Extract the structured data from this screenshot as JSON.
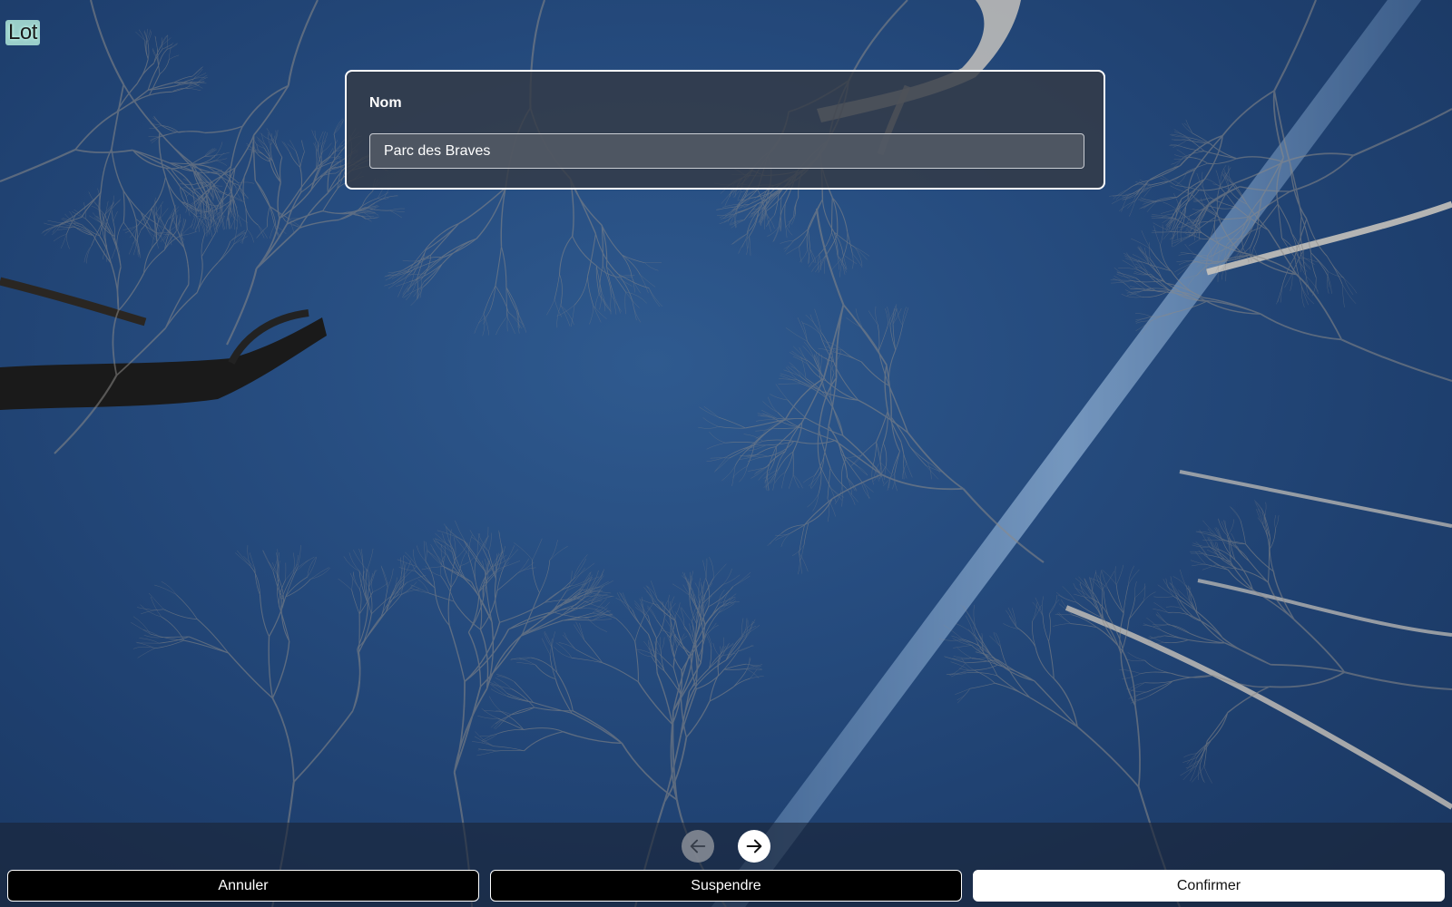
{
  "app": {
    "title": "Lot"
  },
  "form": {
    "name_label": "Nom",
    "name_value": "Parc des Braves"
  },
  "navigation": {
    "prev_icon": "arrow-left-icon",
    "next_icon": "arrow-right-icon",
    "prev_enabled": false,
    "next_enabled": true
  },
  "actions": {
    "cancel_label": "Annuler",
    "suspend_label": "Suspendre",
    "confirm_label": "Confirmer"
  },
  "colors": {
    "sky": "#264c7f",
    "panel": "#343a46",
    "title_highlight": "#c4ffe8"
  }
}
